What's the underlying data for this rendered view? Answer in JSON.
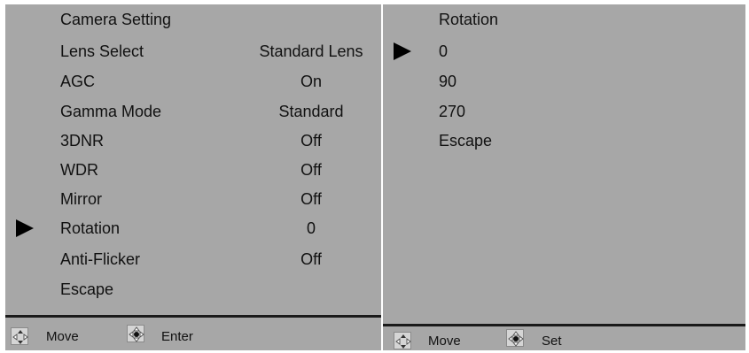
{
  "camera_setting": {
    "title": "Camera Setting",
    "rows": [
      {
        "label": "Lens Select",
        "value": "Standard Lens"
      },
      {
        "label": "AGC",
        "value": "On"
      },
      {
        "label": "Gamma Mode",
        "value": "Standard"
      },
      {
        "label": "3DNR",
        "value": "Off"
      },
      {
        "label": "WDR",
        "value": "Off"
      },
      {
        "label": "Mirror",
        "value": "Off"
      },
      {
        "label": "Rotation",
        "value": "0"
      },
      {
        "label": "Anti-Flicker",
        "value": "Off"
      },
      {
        "label": "Escape",
        "value": ""
      }
    ],
    "selected_row": "Rotation",
    "footer": {
      "move_label": "Move",
      "action_label": "Enter"
    }
  },
  "rotation": {
    "title": "Rotation",
    "options": [
      "0",
      "90",
      "270",
      "Escape"
    ],
    "selected_option": "0",
    "footer": {
      "move_label": "Move",
      "action_label": "Set"
    }
  },
  "icons": {
    "pointer": "triangle-pointer-icon",
    "move": "dpad-move-icon",
    "select": "dpad-select-icon"
  },
  "colors": {
    "panel_background": "#a7a7a7",
    "text": "#111111",
    "pointer": "#000000"
  }
}
